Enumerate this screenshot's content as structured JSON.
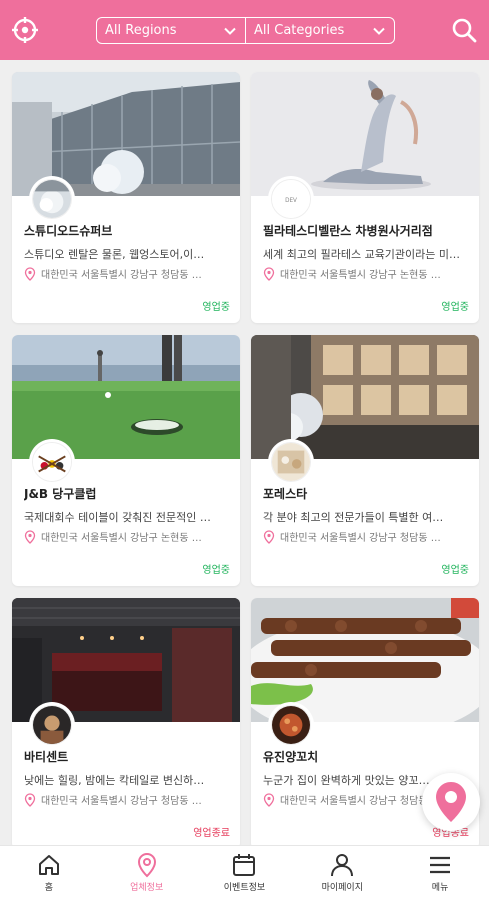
{
  "header": {
    "left_icon": "target-location-icon",
    "region_filter": "All Regions",
    "category_filter": "All Categories",
    "right_icon": "search-icon",
    "accent_color": "#ef6f9c"
  },
  "cards": [
    {
      "title": "스튜디오드슈퍼브",
      "description": "스튜디오 렌탈은 물론, 웹엉스토어,이…",
      "address": "대한민국 서울특별시 강남구 청담동 …",
      "status": "영업중",
      "status_type": "open"
    },
    {
      "title": "필라테스디벨란스 차병원사거리점",
      "description": "세계 최고의 필라테스 교육기관이라는 미…",
      "address": "대한민국 서울특별시 강남구 논현동 …",
      "status": "영업중",
      "status_type": "open"
    },
    {
      "title": "J&B 당구클럽",
      "description": "국제대회수 테이블이 갖춰진 전문적인 …",
      "address": "대한민국 서울특별시 강남구 논현동 …",
      "status": "영업중",
      "status_type": "open"
    },
    {
      "title": "포레스타",
      "description": "각 분야 최고의 전문가들이 특별한 여…",
      "address": "대한민국 서울특별시 강남구 청담동 …",
      "status": "영업중",
      "status_type": "open"
    },
    {
      "title": "바티센트",
      "description": "낮에는 힐링, 밤에는 칵테일로 변신하…",
      "address": "대한민국 서울특별시 강남구 청담동 …",
      "status": "영업종료",
      "status_type": "closed"
    },
    {
      "title": "유진양꼬치",
      "description": "누군가 집이 완벽하게 맛있는 양꼬…",
      "address": "대한민국 서울특별시 강남구 청담동 …",
      "status": "영업종료",
      "status_type": "closed"
    }
  ],
  "fab": {
    "icon": "map-pin-icon"
  },
  "nav": [
    {
      "label": "홈",
      "icon": "home-icon"
    },
    {
      "label": "업체정보",
      "icon": "location-pin-icon"
    },
    {
      "label": "이벤트정보",
      "icon": "calendar-icon"
    },
    {
      "label": "마이페이지",
      "icon": "user-icon"
    },
    {
      "label": "메뉴",
      "icon": "menu-icon"
    }
  ]
}
